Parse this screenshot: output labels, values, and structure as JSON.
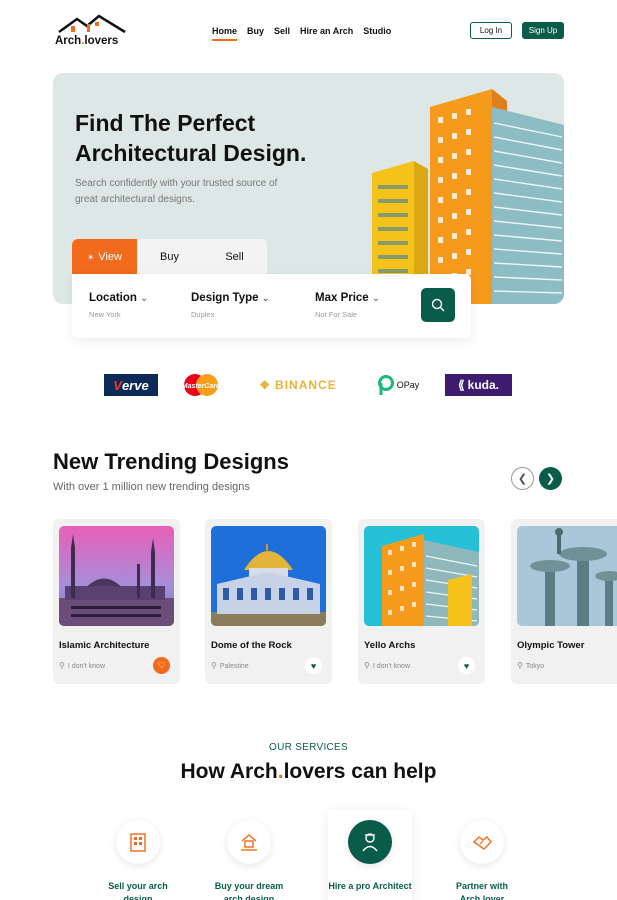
{
  "brand": {
    "name_part1": "Arch",
    "name_dot": ".",
    "name_part2": "lovers",
    "accent": "#f26a1b",
    "primary": "#0a5c4a",
    "icon": "house-roof-logo-icon"
  },
  "nav": {
    "items": [
      {
        "label": "Home",
        "active": true
      },
      {
        "label": "Buy"
      },
      {
        "label": "Sell"
      },
      {
        "label": "Hire an Arch"
      },
      {
        "label": "Studio"
      }
    ],
    "login": "Log In",
    "signup": "Sign Up"
  },
  "hero": {
    "title": "Find The Perfect Architectural Design.",
    "subtitle": "Search confidently with your trusted source of great architectural designs."
  },
  "search": {
    "tabs": [
      "View",
      "Buy",
      "Sell"
    ],
    "active_tab_icon": "sun-icon",
    "fields": [
      {
        "label": "Location",
        "value": "New York"
      },
      {
        "label": "Design Type",
        "value": "Duplex"
      },
      {
        "label": "Max Price",
        "value": "Not For Sale"
      }
    ],
    "button_icon": "search-icon"
  },
  "partners": {
    "verve_v": "V",
    "verve_rest": "erve",
    "mastercard": "MasterCard",
    "binance": "BINANCE",
    "opay": "OPay",
    "kuda": "kuda."
  },
  "trending": {
    "title": "New Trending Designs",
    "subtitle": "With over 1 million new trending designs",
    "prev_icon": "chevron-left-icon",
    "next_icon": "chevron-right-icon",
    "cards": [
      {
        "name": "Islamic Architecture",
        "location": "I don't know",
        "favorited": true
      },
      {
        "name": "Dome of the Rock",
        "location": "Palestine",
        "favorited": false
      },
      {
        "name": "Yello Archs",
        "location": "I don't know",
        "favorited": false
      },
      {
        "name": "Olympic Tower",
        "location": "Tokyo",
        "favorited": false
      }
    ]
  },
  "services": {
    "kicker": "OUR SERVICES",
    "title_part1": "How Arch",
    "title_dot": ".",
    "title_part2": "lovers can help",
    "items": [
      {
        "label": "Sell your arch design",
        "icon": "building-icon"
      },
      {
        "label": "Buy your dream arch design",
        "icon": "house-hand-icon"
      },
      {
        "label": "Hire a pro Architect",
        "icon": "architect-icon"
      },
      {
        "label": "Partner with Arch.lover",
        "icon": "handshake-icon"
      }
    ]
  }
}
